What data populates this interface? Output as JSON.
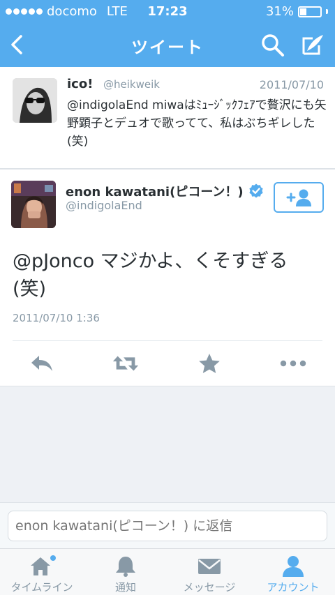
{
  "status_bar": {
    "carrier": "docomo",
    "network": "LTE",
    "time": "17:23",
    "battery": "31%",
    "battery_level": 0.31
  },
  "nav": {
    "title": "ツイート",
    "icons": [
      "back-chevron-icon",
      "search-icon",
      "compose-icon"
    ]
  },
  "context_tweet": {
    "name": "ico!",
    "handle": "@heikweik",
    "date": "2011/07/10",
    "text": "@indigolaEnd miwaはﾐｭｰｼﾞｯｸﾌｪｱで贅沢にも矢野顕子とデュオで歌ってて、私はぶちギレした(笑)"
  },
  "main_tweet": {
    "name": "enon kawatani(ピコーン！)",
    "handle": "@indigolaEnd",
    "verified": true,
    "text": "@pJonco マジかよ、くそすぎる(笑)",
    "timestamp": "2011/07/10 1:36",
    "actions": [
      "reply-icon",
      "retweet-icon",
      "favorite-star-icon",
      "more-icon"
    ]
  },
  "reply": {
    "placeholder": "enon kawatani(ピコーン！) に返信"
  },
  "tabbar": {
    "items": [
      {
        "label": "タイムライン",
        "icon": "home-icon",
        "badge": true
      },
      {
        "label": "通知",
        "icon": "bell-icon"
      },
      {
        "label": "メッセージ",
        "icon": "envelope-icon"
      },
      {
        "label": "アカウント",
        "icon": "person-icon",
        "active": true
      }
    ]
  },
  "colors": {
    "accent": "#55acee",
    "text": "#292f33",
    "muted": "#8899a6",
    "background": "#eef1f5"
  }
}
